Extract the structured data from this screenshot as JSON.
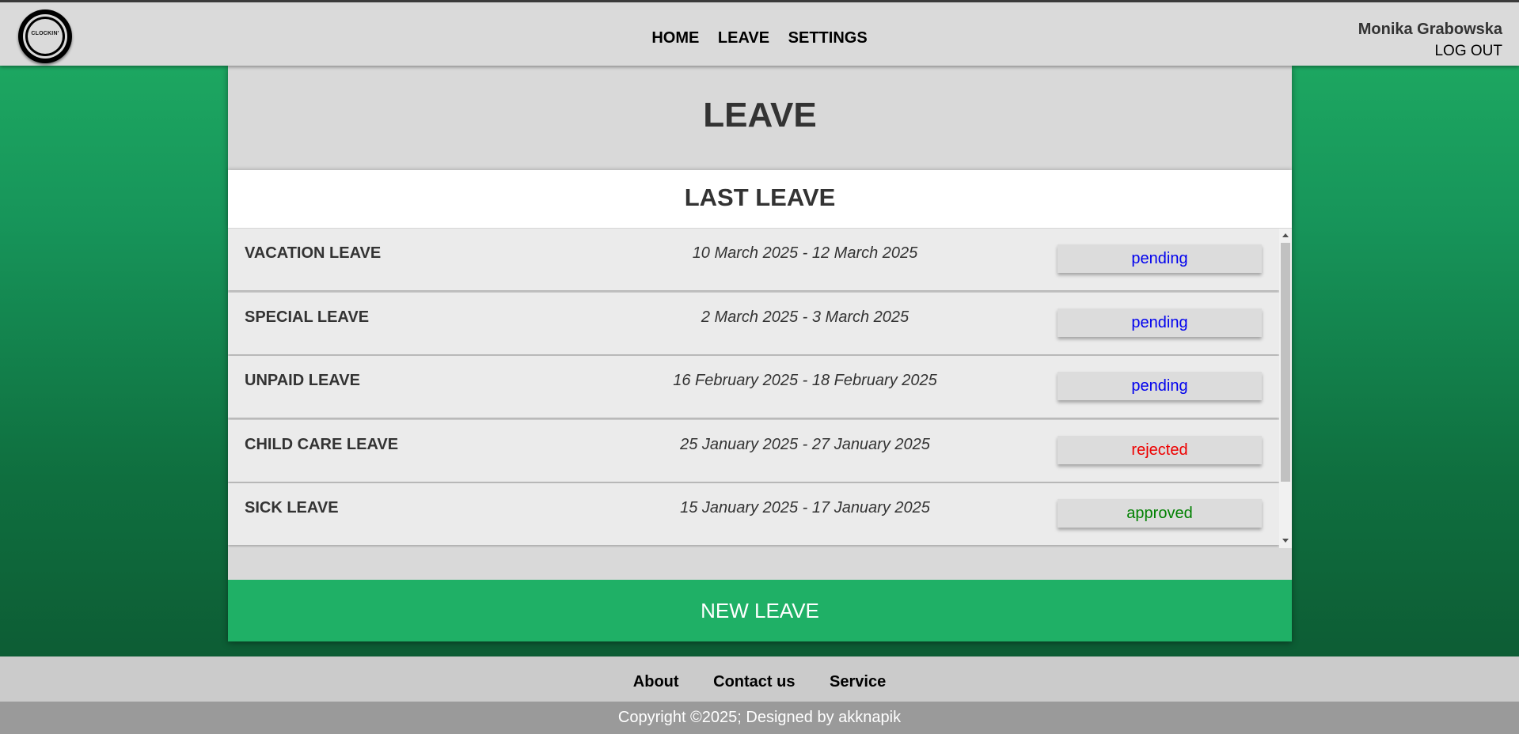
{
  "header": {
    "logo_text": "CLOCKIN'",
    "nav": [
      "HOME",
      "LEAVE",
      "SETTINGS"
    ],
    "user_name": "Monika Grabowska",
    "logout_label": "LOG OUT"
  },
  "page": {
    "title": "LEAVE",
    "section_title": "LAST LEAVE",
    "leaves": [
      {
        "type": "VACATION LEAVE",
        "dates": "10 March 2025 - 12 March 2025",
        "status": "pending",
        "status_color": "#0000ee"
      },
      {
        "type": "SPECIAL LEAVE",
        "dates": "2 March 2025 - 3 March 2025",
        "status": "pending",
        "status_color": "#0000ee"
      },
      {
        "type": "UNPAID LEAVE",
        "dates": "16 February 2025 - 18 February 2025",
        "status": "pending",
        "status_color": "#0000ee"
      },
      {
        "type": "CHILD CARE LEAVE",
        "dates": "25 January 2025 - 27 January 2025",
        "status": "rejected",
        "status_color": "#ee0000"
      },
      {
        "type": "SICK LEAVE",
        "dates": "15 January 2025 - 17 January 2025",
        "status": "approved",
        "status_color": "#008000"
      }
    ],
    "new_leave_label": "NEW LEAVE"
  },
  "footer": {
    "links": [
      "About",
      "Contact us",
      "Service"
    ],
    "copyright": "Copyright ©2025; Designed by akknapik"
  },
  "colors": {
    "accent": "#1fb066",
    "header_bg": "#dadada"
  }
}
